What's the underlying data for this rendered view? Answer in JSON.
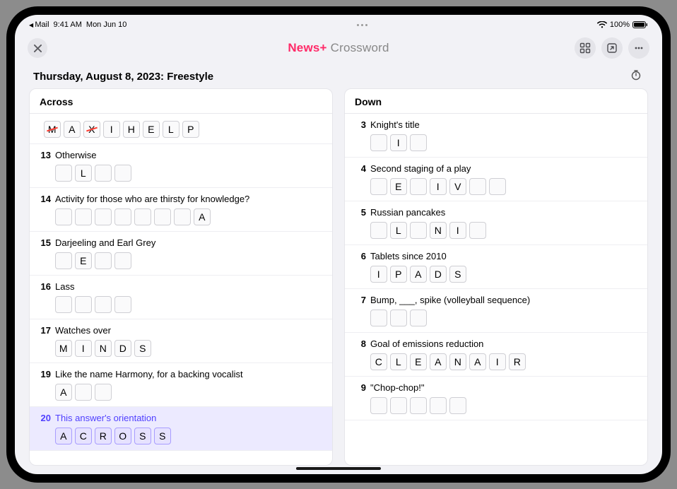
{
  "status": {
    "back_app": "Mail",
    "time": "9:41 AM",
    "date": "Mon Jun 10",
    "battery_pct": "100%"
  },
  "nav": {
    "brand": "News+",
    "subtitle": "Crossword"
  },
  "subtitle": "Thursday, August 8, 2023: Freestyle",
  "columns": {
    "across": {
      "title": "Across"
    },
    "down": {
      "title": "Down"
    }
  },
  "across": [
    {
      "num": "",
      "clue": "",
      "cells": [
        {
          "l": "M",
          "wrong": true
        },
        {
          "l": "A"
        },
        {
          "l": "X",
          "wrong": true
        },
        {
          "l": "I"
        },
        {
          "l": "H"
        },
        {
          "l": "E"
        },
        {
          "l": "L"
        },
        {
          "l": "P"
        }
      ],
      "first": true
    },
    {
      "num": "13",
      "clue": "Otherwise",
      "cells": [
        {
          "l": ""
        },
        {
          "l": "L"
        },
        {
          "l": ""
        },
        {
          "l": ""
        }
      ]
    },
    {
      "num": "14",
      "clue": "Activity for those who are thirsty for knowledge?",
      "cells": [
        {
          "l": ""
        },
        {
          "l": ""
        },
        {
          "l": ""
        },
        {
          "l": ""
        },
        {
          "l": ""
        },
        {
          "l": ""
        },
        {
          "l": ""
        },
        {
          "l": "A"
        }
      ]
    },
    {
      "num": "15",
      "clue": "Darjeeling and Earl Grey",
      "cells": [
        {
          "l": ""
        },
        {
          "l": "E"
        },
        {
          "l": ""
        },
        {
          "l": ""
        }
      ]
    },
    {
      "num": "16",
      "clue": "Lass",
      "cells": [
        {
          "l": ""
        },
        {
          "l": ""
        },
        {
          "l": ""
        },
        {
          "l": ""
        }
      ]
    },
    {
      "num": "17",
      "clue": "Watches over",
      "cells": [
        {
          "l": "M"
        },
        {
          "l": "I"
        },
        {
          "l": "N"
        },
        {
          "l": "D"
        },
        {
          "l": "S"
        }
      ]
    },
    {
      "num": "19",
      "clue": "Like the name Harmony, for a backing vocalist",
      "cells": [
        {
          "l": "A"
        },
        {
          "l": ""
        },
        {
          "l": ""
        }
      ]
    },
    {
      "num": "20",
      "clue": "This answer's orientation",
      "selected": true,
      "cells": [
        {
          "l": "A",
          "sel": true
        },
        {
          "l": "C",
          "sel": true
        },
        {
          "l": "R",
          "sel": true
        },
        {
          "l": "O",
          "sel": true
        },
        {
          "l": "S",
          "sel": true
        },
        {
          "l": "S",
          "sel": true
        }
      ]
    }
  ],
  "down": [
    {
      "num": "3",
      "clue": "Knight's title",
      "cells": [
        {
          "l": ""
        },
        {
          "l": "I"
        },
        {
          "l": ""
        }
      ]
    },
    {
      "num": "4",
      "clue": "Second staging of a play",
      "cells": [
        {
          "l": ""
        },
        {
          "l": "E"
        },
        {
          "l": ""
        },
        {
          "l": "I"
        },
        {
          "l": "V"
        },
        {
          "l": ""
        },
        {
          "l": ""
        }
      ]
    },
    {
      "num": "5",
      "clue": "Russian pancakes",
      "cells": [
        {
          "l": ""
        },
        {
          "l": "L"
        },
        {
          "l": ""
        },
        {
          "l": "N"
        },
        {
          "l": "I"
        },
        {
          "l": ""
        }
      ]
    },
    {
      "num": "6",
      "clue": "Tablets since 2010",
      "cells": [
        {
          "l": "I"
        },
        {
          "l": "P"
        },
        {
          "l": "A"
        },
        {
          "l": "D"
        },
        {
          "l": "S"
        }
      ]
    },
    {
      "num": "7",
      "clue": "Bump, ___, spike (volleyball sequence)",
      "cells": [
        {
          "l": ""
        },
        {
          "l": ""
        },
        {
          "l": ""
        }
      ]
    },
    {
      "num": "8",
      "clue": "Goal of emissions reduction",
      "cells": [
        {
          "l": "C"
        },
        {
          "l": "L"
        },
        {
          "l": "E"
        },
        {
          "l": "A"
        },
        {
          "l": "N"
        },
        {
          "l": "A"
        },
        {
          "l": "I"
        },
        {
          "l": "R"
        }
      ]
    },
    {
      "num": "9",
      "clue": "\"Chop-chop!\"",
      "cells": [
        {
          "l": ""
        },
        {
          "l": ""
        },
        {
          "l": ""
        },
        {
          "l": ""
        },
        {
          "l": ""
        }
      ]
    }
  ]
}
